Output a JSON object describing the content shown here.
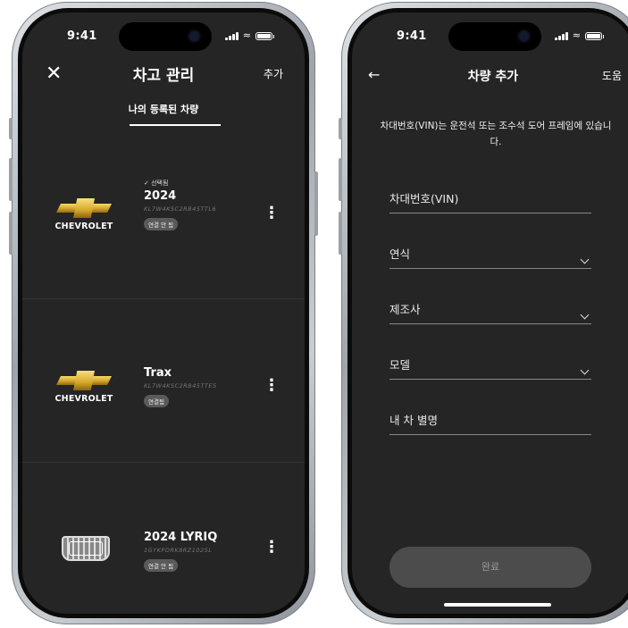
{
  "status": {
    "time": "9:41"
  },
  "left": {
    "header": {
      "title": "차고 관리",
      "action": "추가",
      "close_icon": "close-icon"
    },
    "tab": "나의 등록된 차량",
    "vehicles": [
      {
        "brand": "CHEVROLET",
        "selected_label": "✓ 선택됨",
        "name": "2024",
        "vin": "KL7W4KSC2RB45TTL6",
        "status": "연결 안 됨"
      },
      {
        "brand": "CHEVROLET",
        "selected_label": "",
        "name": "Trax",
        "vin": "KL7W4KSC2RB45TTE5",
        "status": "연결됨"
      },
      {
        "brand": "",
        "selected_label": "",
        "name": "2024 LYRIQ",
        "vin": "1GYKPDRK8RZ1025L",
        "status": "연결 안 됨"
      }
    ]
  },
  "right": {
    "header": {
      "title": "차량 추가",
      "action": "도움"
    },
    "hint": "차대번호(VIN)는 운전석 또는 조수석 도어 프레임에 있습니다.",
    "fields": [
      {
        "label": "차대번호(VIN)",
        "dropdown": false
      },
      {
        "label": "연식",
        "dropdown": true
      },
      {
        "label": "제조사",
        "dropdown": true
      },
      {
        "label": "모델",
        "dropdown": true
      },
      {
        "label": "내 차 별명",
        "dropdown": false
      }
    ],
    "submit": "완료"
  }
}
